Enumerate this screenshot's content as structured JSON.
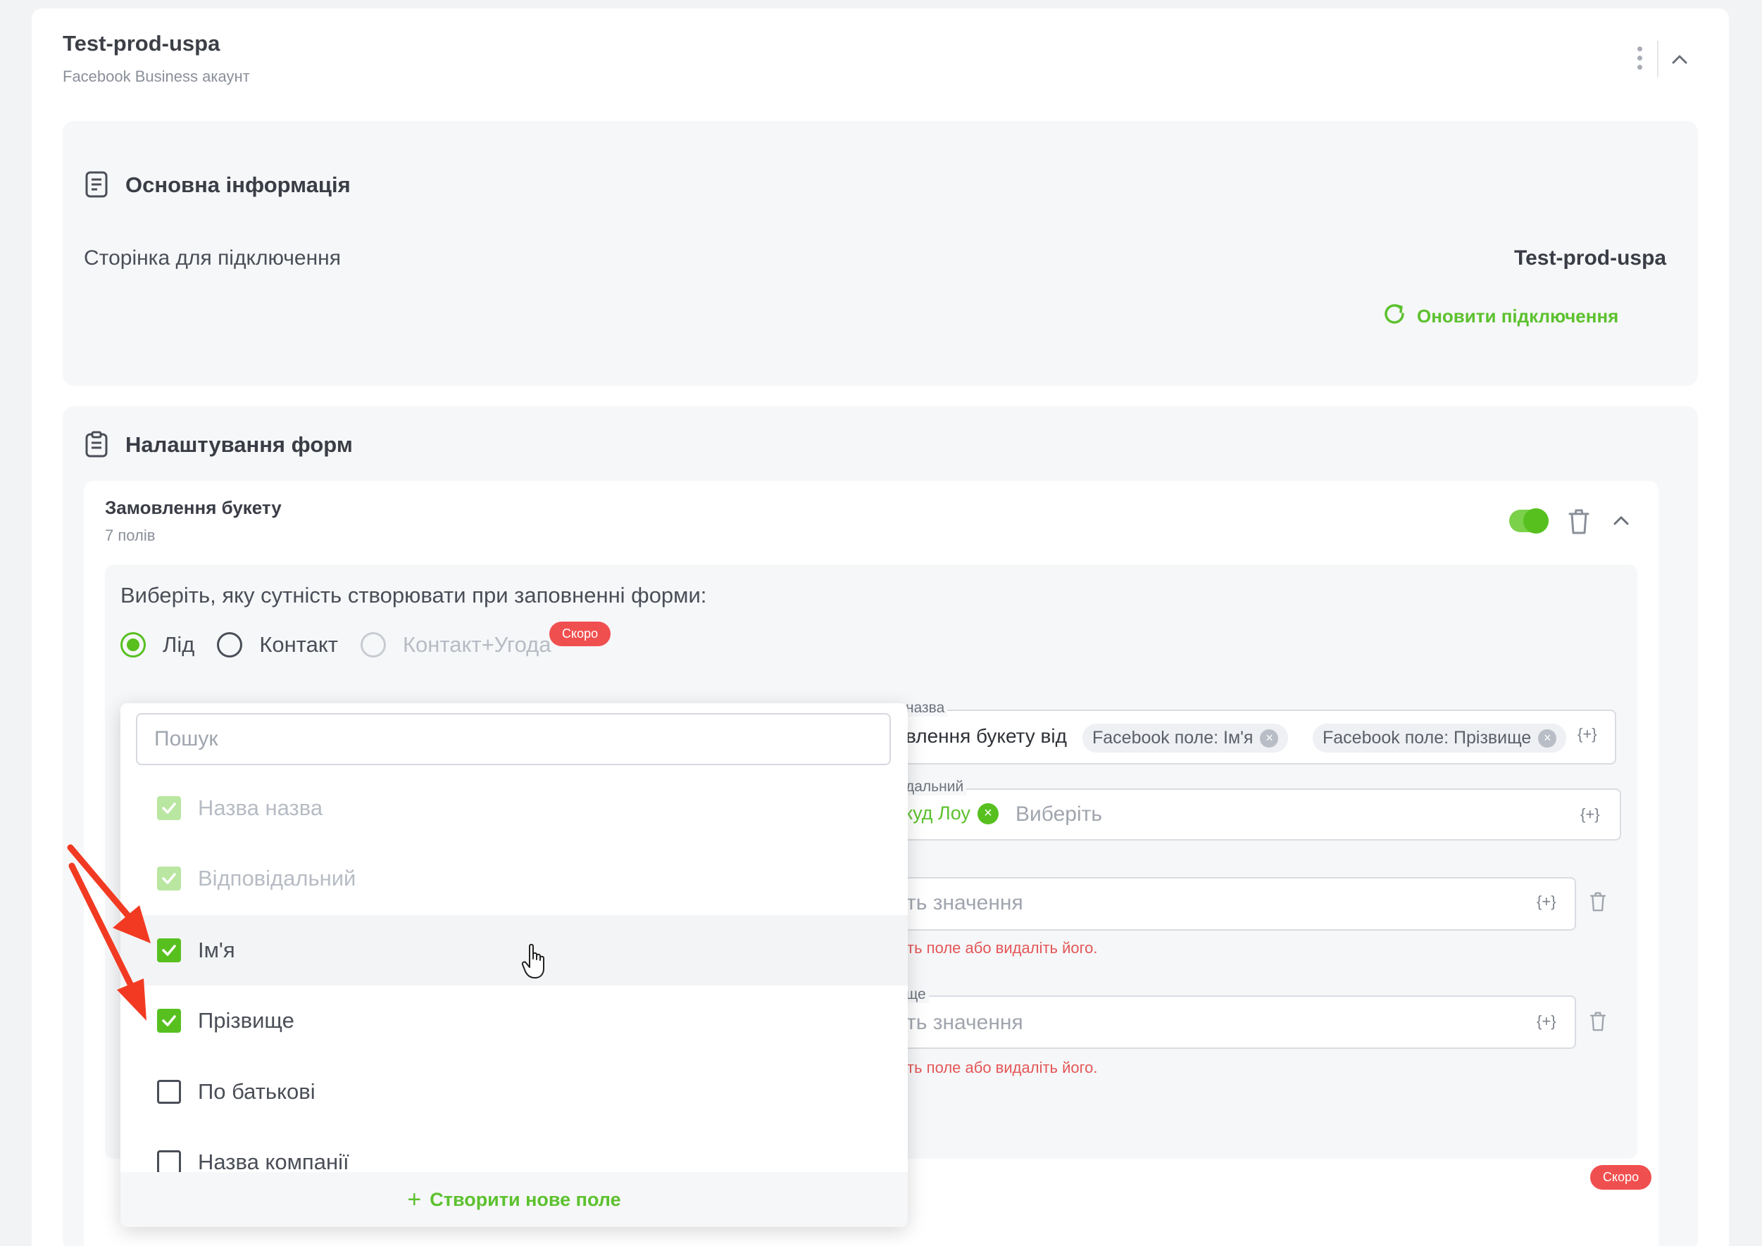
{
  "account": {
    "title": "Test-prod-uspa",
    "subtitle": "Facebook Business акаунт"
  },
  "basic_info": {
    "title": "Основна інформація",
    "page_label": "Сторінка для підключення",
    "page_value": "Test-prod-uspa",
    "refresh_label": "Оновити підключення"
  },
  "forms_settings": {
    "title": "Налаштування форм"
  },
  "form": {
    "title": "Замовлення букету",
    "subtitle": "7 полів",
    "enabled": true,
    "question": "Виберіть, яку сутність створювати при заповненні форми:",
    "radios": [
      {
        "label": "Лід",
        "selected": true
      },
      {
        "label": "Контакт",
        "selected": false
      },
      {
        "label": "Контакт+Угода",
        "selected": false,
        "disabled": true
      }
    ],
    "soon_badge": "Скоро",
    "soon_badge_bottom": "Скоро"
  },
  "fields": {
    "name_label": "назва",
    "name_text": "влення букету від",
    "name_chips": [
      "Facebook поле: Ім'я",
      "Facebook поле: Прізвище"
    ],
    "plus_tag": "{+}",
    "responsible_label": "дальний",
    "responsible_chip": "куд Лоу",
    "responsible_placeholder": "Виберіть",
    "value_placeholder_1": "ть значення",
    "error_1": "ть поле або видаліть його.",
    "surname_label": "ще",
    "value_placeholder_2": "ть значення",
    "error_2": "ть поле або видаліть його."
  },
  "dropdown": {
    "search_placeholder": "Пошук",
    "options": [
      {
        "label": "Назва назва",
        "checked": true,
        "disabled": true
      },
      {
        "label": "Відповідальний",
        "checked": true,
        "disabled": true
      },
      {
        "label": "Ім'я",
        "checked": true,
        "disabled": false
      },
      {
        "label": "Прізвище",
        "checked": true,
        "disabled": false
      },
      {
        "label": "По батькові",
        "checked": false,
        "disabled": false
      },
      {
        "label": "Назва компанії",
        "checked": false,
        "disabled": false
      }
    ],
    "create_label": "Створити нове поле",
    "create_plus": "+"
  },
  "colors": {
    "accent_green": "#57c01f",
    "error_red": "#e45656",
    "badge_red": "#f04f4f",
    "annotation_arrow": "#f23a22"
  },
  "icons": {
    "more": "kebab-icon",
    "collapse": "chevron-up-icon",
    "info": "document-icon",
    "forms": "clipboard-icon",
    "refresh": "refresh-icon",
    "delete": "trash-icon"
  }
}
